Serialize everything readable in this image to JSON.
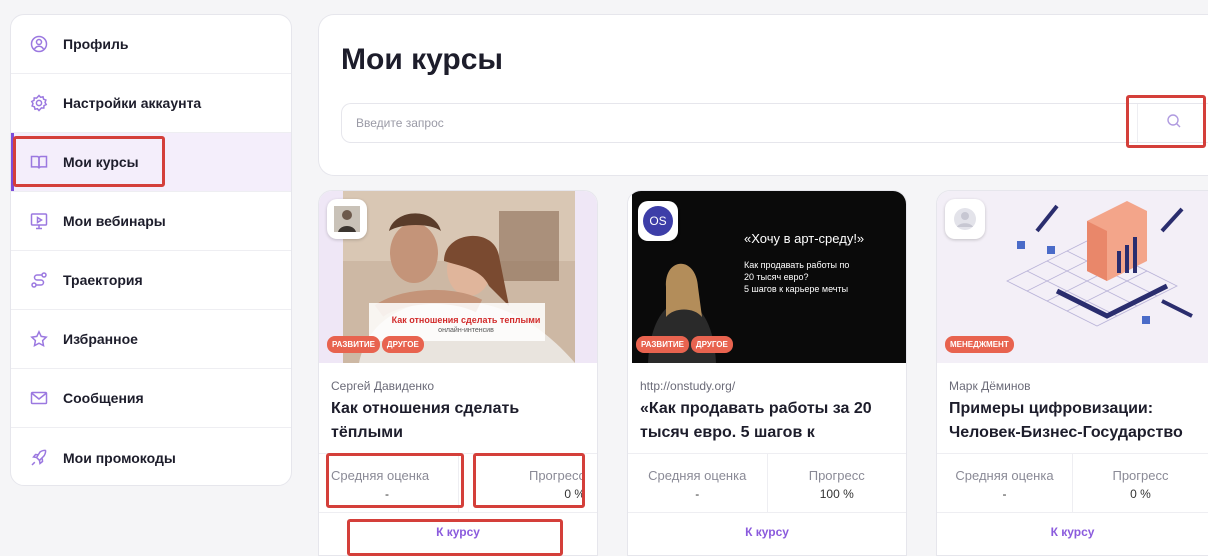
{
  "sidebar": {
    "items": [
      {
        "label": "Профиль",
        "icon": "user-circle-icon"
      },
      {
        "label": "Настройки аккаунта",
        "icon": "gear-icon"
      },
      {
        "label": "Мои курсы",
        "icon": "book-icon",
        "active": true
      },
      {
        "label": "Мои вебинары",
        "icon": "presentation-icon"
      },
      {
        "label": "Траектория",
        "icon": "route-icon"
      },
      {
        "label": "Избранное",
        "icon": "star-icon"
      },
      {
        "label": "Сообщения",
        "icon": "mail-icon"
      },
      {
        "label": "Мои промокоды",
        "icon": "rocket-icon"
      }
    ]
  },
  "main": {
    "title": "Мои курсы",
    "search": {
      "placeholder": "Введите запрос",
      "icon": "search-icon"
    }
  },
  "courses": [
    {
      "author": "Сергей Давиденко",
      "title": "Как отношения сделать тёплыми",
      "tags": [
        "РАЗВИТИЕ",
        "ДРУГОЕ"
      ],
      "cover_caption": "Как отношения сделать теплыми",
      "cover_subcaption": "онлайн-интенсив",
      "rating_label": "Средняя оценка",
      "rating_value": "-",
      "progress_label": "Прогресс",
      "progress_value": "0 %",
      "button": "К курсу"
    },
    {
      "author": "http://onstudy.org/",
      "title": "«Как продавать работы за 20 тысяч евро. 5 шагов к",
      "tags": [
        "РАЗВИТИЕ",
        "ДРУГОЕ"
      ],
      "cover_logo": "OS",
      "cover_heading": "«Хочу в арт-среду!»",
      "cover_lines": [
        "Как продавать работы по",
        "20 тысяч евро?",
        "5 шагов к карьере мечты"
      ],
      "rating_label": "Средняя оценка",
      "rating_value": "-",
      "progress_label": "Прогресс",
      "progress_value": "100 %",
      "button": "К курсу"
    },
    {
      "author": "Марк Дёминов",
      "title": "Примеры цифровизации: Человек-Бизнес-Государство",
      "tags": [
        "МЕНЕДЖМЕНТ"
      ],
      "rating_label": "Средняя оценка",
      "rating_value": "-",
      "progress_label": "Прогресс",
      "progress_value": "0 %",
      "button": "К курсу"
    }
  ],
  "colors": {
    "accent": "#8b5bdd",
    "highlight": "#d43f3a",
    "tag": "#e8634f"
  }
}
